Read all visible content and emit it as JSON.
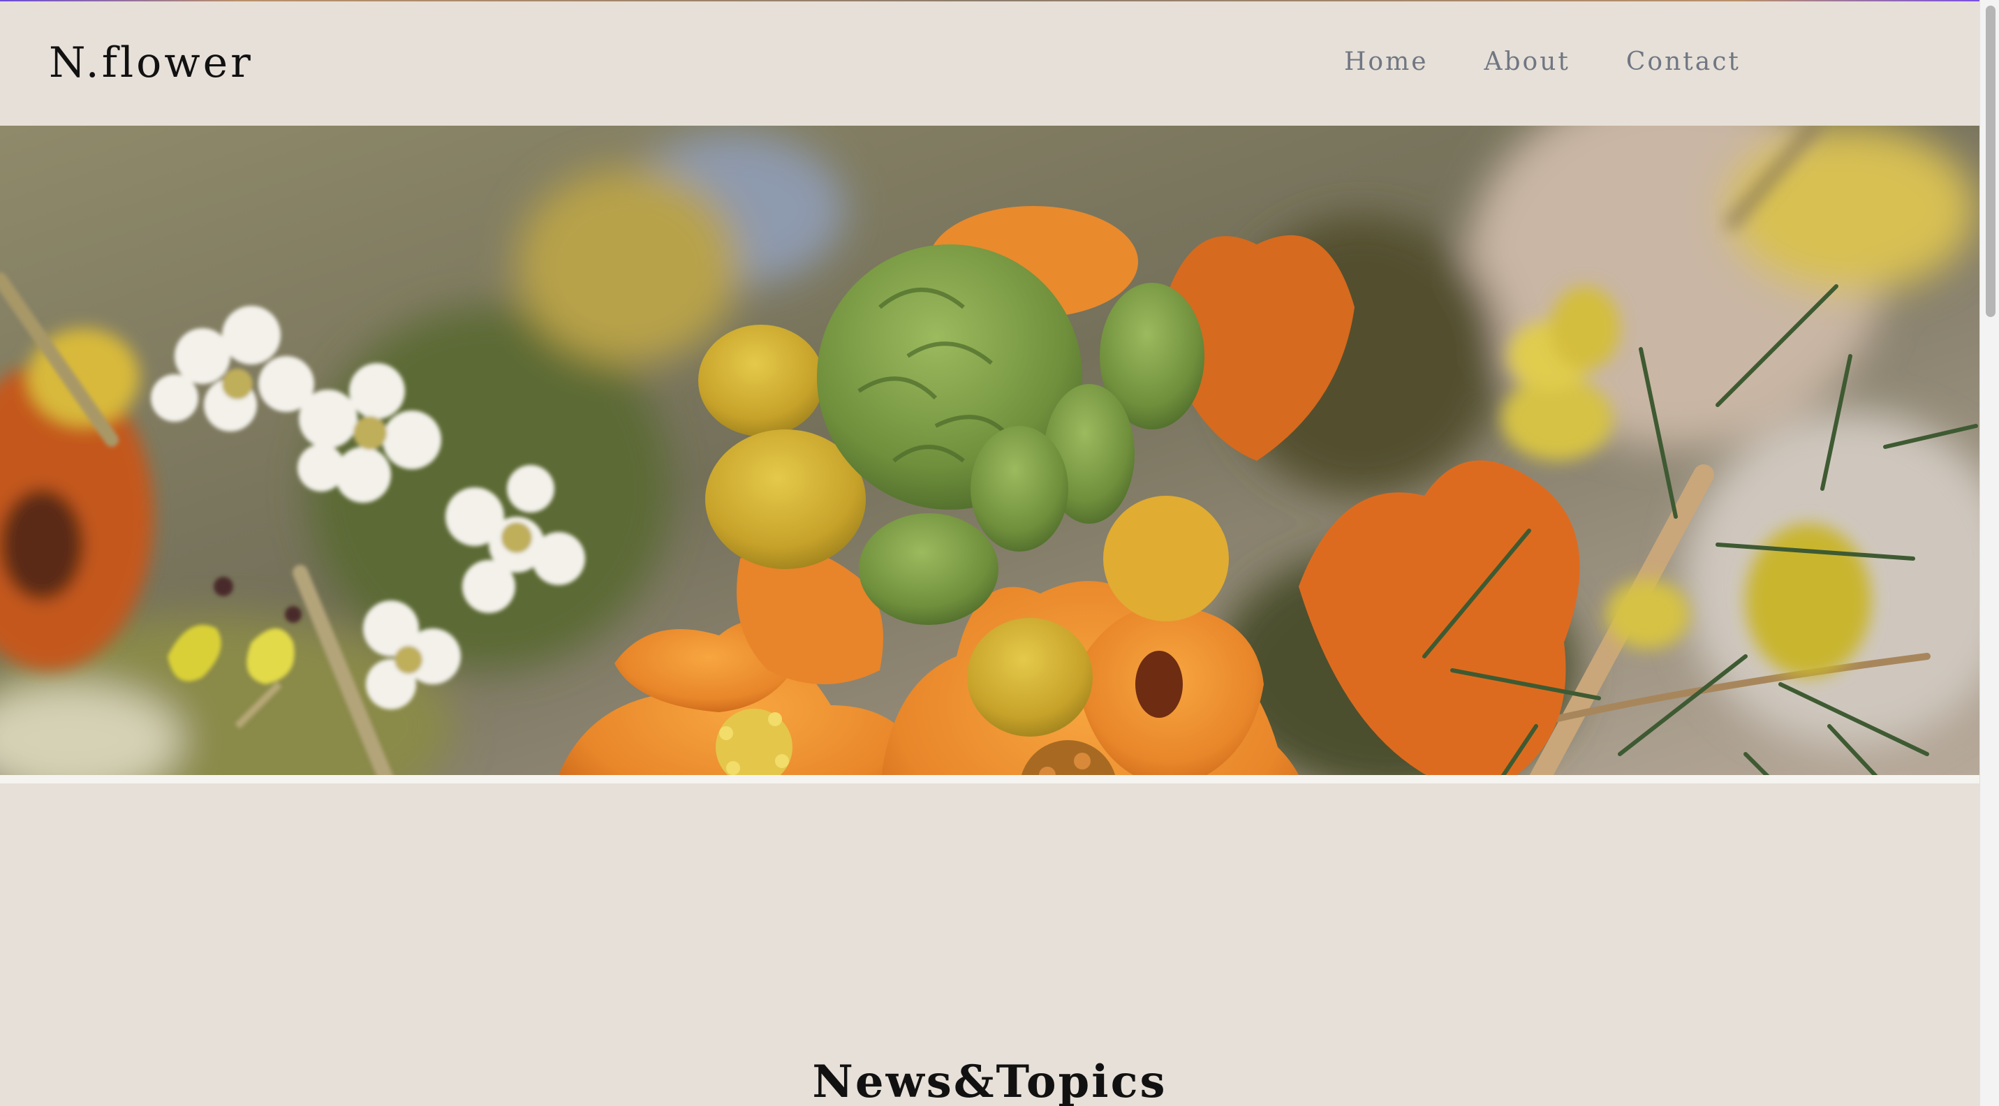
{
  "site": {
    "logo": "N.flower"
  },
  "nav": {
    "items": [
      {
        "label": "Home"
      },
      {
        "label": "About"
      },
      {
        "label": "Contact"
      }
    ]
  },
  "hero": {
    "image": "flower-bouquet-photo"
  },
  "main": {
    "section_title": "News&Topics"
  },
  "colors": {
    "page_bg": "#e7e0d8",
    "nav_text": "#707783",
    "title_text": "#111111",
    "flower_orange": "#e8882a",
    "flower_green": "#7a9a45"
  }
}
